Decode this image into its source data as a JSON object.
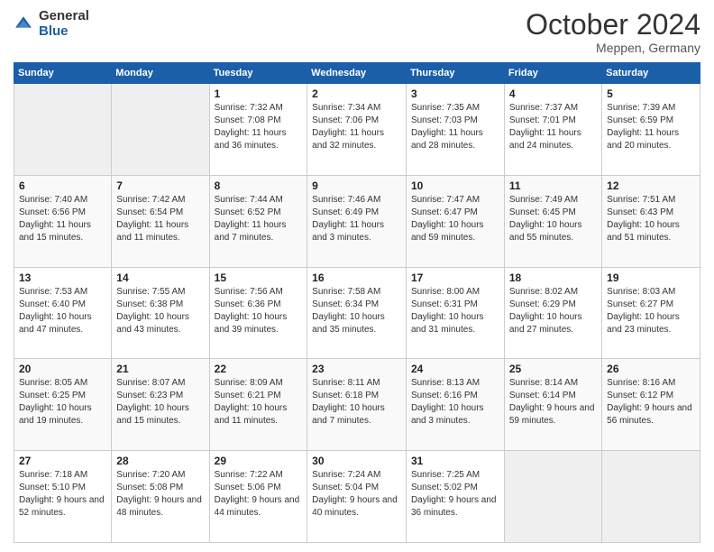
{
  "logo": {
    "general": "General",
    "blue": "Blue"
  },
  "title": "October 2024",
  "location": "Meppen, Germany",
  "weekdays": [
    "Sunday",
    "Monday",
    "Tuesday",
    "Wednesday",
    "Thursday",
    "Friday",
    "Saturday"
  ],
  "weeks": [
    [
      {
        "day": "",
        "empty": true
      },
      {
        "day": "",
        "empty": true
      },
      {
        "day": "1",
        "sunrise": "7:32 AM",
        "sunset": "7:08 PM",
        "daylight": "11 hours and 36 minutes."
      },
      {
        "day": "2",
        "sunrise": "7:34 AM",
        "sunset": "7:06 PM",
        "daylight": "11 hours and 32 minutes."
      },
      {
        "day": "3",
        "sunrise": "7:35 AM",
        "sunset": "7:03 PM",
        "daylight": "11 hours and 28 minutes."
      },
      {
        "day": "4",
        "sunrise": "7:37 AM",
        "sunset": "7:01 PM",
        "daylight": "11 hours and 24 minutes."
      },
      {
        "day": "5",
        "sunrise": "7:39 AM",
        "sunset": "6:59 PM",
        "daylight": "11 hours and 20 minutes."
      }
    ],
    [
      {
        "day": "6",
        "sunrise": "7:40 AM",
        "sunset": "6:56 PM",
        "daylight": "11 hours and 15 minutes."
      },
      {
        "day": "7",
        "sunrise": "7:42 AM",
        "sunset": "6:54 PM",
        "daylight": "11 hours and 11 minutes."
      },
      {
        "day": "8",
        "sunrise": "7:44 AM",
        "sunset": "6:52 PM",
        "daylight": "11 hours and 7 minutes."
      },
      {
        "day": "9",
        "sunrise": "7:46 AM",
        "sunset": "6:49 PM",
        "daylight": "11 hours and 3 minutes."
      },
      {
        "day": "10",
        "sunrise": "7:47 AM",
        "sunset": "6:47 PM",
        "daylight": "10 hours and 59 minutes."
      },
      {
        "day": "11",
        "sunrise": "7:49 AM",
        "sunset": "6:45 PM",
        "daylight": "10 hours and 55 minutes."
      },
      {
        "day": "12",
        "sunrise": "7:51 AM",
        "sunset": "6:43 PM",
        "daylight": "10 hours and 51 minutes."
      }
    ],
    [
      {
        "day": "13",
        "sunrise": "7:53 AM",
        "sunset": "6:40 PM",
        "daylight": "10 hours and 47 minutes."
      },
      {
        "day": "14",
        "sunrise": "7:55 AM",
        "sunset": "6:38 PM",
        "daylight": "10 hours and 43 minutes."
      },
      {
        "day": "15",
        "sunrise": "7:56 AM",
        "sunset": "6:36 PM",
        "daylight": "10 hours and 39 minutes."
      },
      {
        "day": "16",
        "sunrise": "7:58 AM",
        "sunset": "6:34 PM",
        "daylight": "10 hours and 35 minutes."
      },
      {
        "day": "17",
        "sunrise": "8:00 AM",
        "sunset": "6:31 PM",
        "daylight": "10 hours and 31 minutes."
      },
      {
        "day": "18",
        "sunrise": "8:02 AM",
        "sunset": "6:29 PM",
        "daylight": "10 hours and 27 minutes."
      },
      {
        "day": "19",
        "sunrise": "8:03 AM",
        "sunset": "6:27 PM",
        "daylight": "10 hours and 23 minutes."
      }
    ],
    [
      {
        "day": "20",
        "sunrise": "8:05 AM",
        "sunset": "6:25 PM",
        "daylight": "10 hours and 19 minutes."
      },
      {
        "day": "21",
        "sunrise": "8:07 AM",
        "sunset": "6:23 PM",
        "daylight": "10 hours and 15 minutes."
      },
      {
        "day": "22",
        "sunrise": "8:09 AM",
        "sunset": "6:21 PM",
        "daylight": "10 hours and 11 minutes."
      },
      {
        "day": "23",
        "sunrise": "8:11 AM",
        "sunset": "6:18 PM",
        "daylight": "10 hours and 7 minutes."
      },
      {
        "day": "24",
        "sunrise": "8:13 AM",
        "sunset": "6:16 PM",
        "daylight": "10 hours and 3 minutes."
      },
      {
        "day": "25",
        "sunrise": "8:14 AM",
        "sunset": "6:14 PM",
        "daylight": "9 hours and 59 minutes."
      },
      {
        "day": "26",
        "sunrise": "8:16 AM",
        "sunset": "6:12 PM",
        "daylight": "9 hours and 56 minutes."
      }
    ],
    [
      {
        "day": "27",
        "sunrise": "7:18 AM",
        "sunset": "5:10 PM",
        "daylight": "9 hours and 52 minutes."
      },
      {
        "day": "28",
        "sunrise": "7:20 AM",
        "sunset": "5:08 PM",
        "daylight": "9 hours and 48 minutes."
      },
      {
        "day": "29",
        "sunrise": "7:22 AM",
        "sunset": "5:06 PM",
        "daylight": "9 hours and 44 minutes."
      },
      {
        "day": "30",
        "sunrise": "7:24 AM",
        "sunset": "5:04 PM",
        "daylight": "9 hours and 40 minutes."
      },
      {
        "day": "31",
        "sunrise": "7:25 AM",
        "sunset": "5:02 PM",
        "daylight": "9 hours and 36 minutes."
      },
      {
        "day": "",
        "empty": true
      },
      {
        "day": "",
        "empty": true
      }
    ]
  ]
}
